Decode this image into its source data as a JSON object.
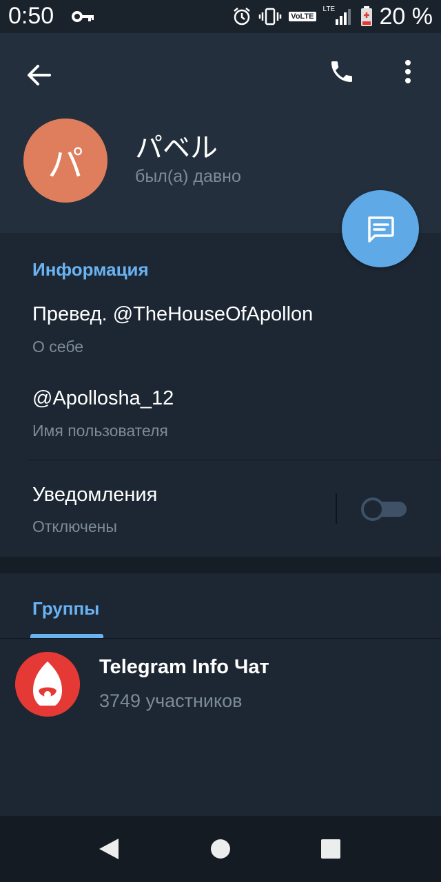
{
  "status_bar": {
    "time": "0:50",
    "network_badge": "VoLTE",
    "lte_label": "LTE",
    "battery_percent": "20 %",
    "icons": [
      "key-icon",
      "alarm-icon",
      "vibrate-icon",
      "signal-icon",
      "battery-icon"
    ]
  },
  "header": {
    "back_icon": "arrow-left-icon",
    "call_icon": "phone-icon",
    "menu_icon": "more-vertical-icon",
    "avatar_initial": "パ",
    "avatar_color": "#df7e5c",
    "name": "パベル",
    "last_seen": "был(а) давно",
    "fab_icon": "message-icon"
  },
  "info": {
    "title": "Информация",
    "bio": "Превед. @TheHouseOfApollon",
    "bio_label": "О себе",
    "username": "@Apollosha_12",
    "username_label": "Имя пользователя",
    "notifications": "Уведомления",
    "notifications_state": "Отключены",
    "notifications_enabled": false
  },
  "groups": {
    "title": "Группы",
    "items": [
      {
        "name": "Telegram Info Чат",
        "members": "3749 участников",
        "avatar_color": "#e53935"
      }
    ]
  },
  "navbar": {
    "back": "triangle-back-icon",
    "home": "circle-home-icon",
    "recents": "square-recents-icon"
  },
  "colors": {
    "accent": "#6ab3f3",
    "fab": "#5ea9e6",
    "background": "#1d2733",
    "header_bg": "#242f3d",
    "secondary_text": "#7d8b99"
  }
}
